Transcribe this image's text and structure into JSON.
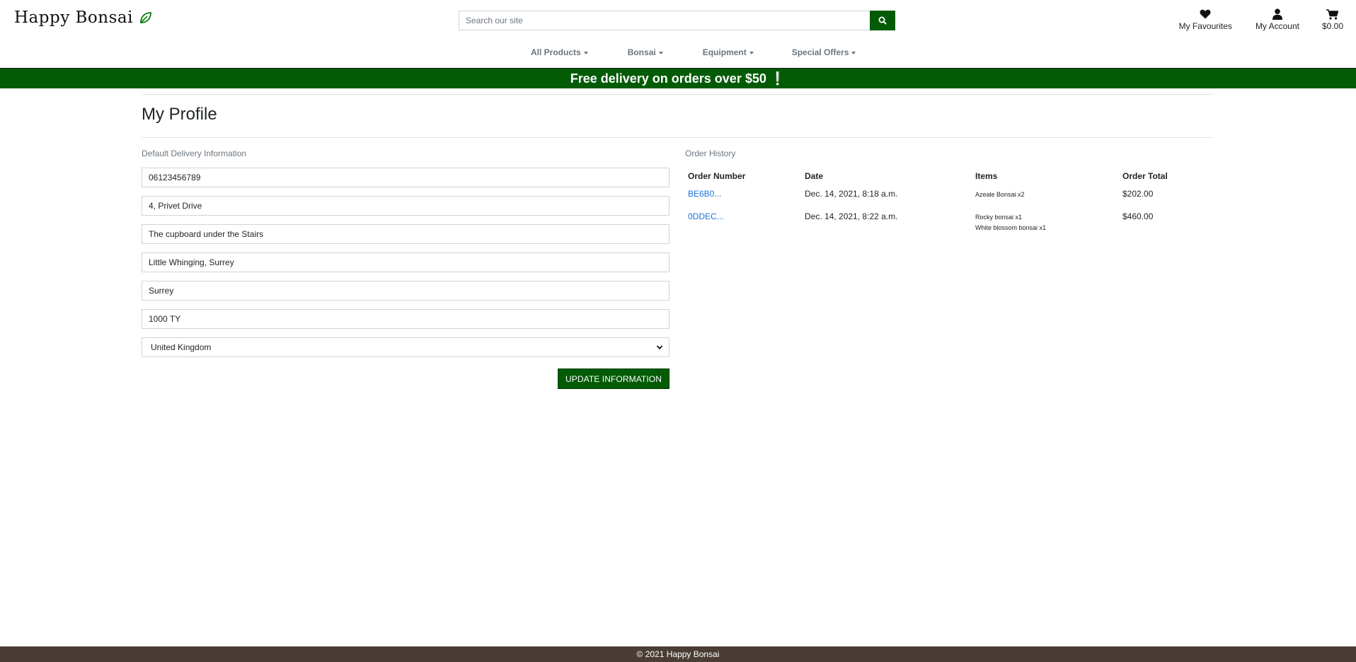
{
  "header": {
    "logo_text": "Happy Bonsai",
    "search_placeholder": "Search our site",
    "favourites_label": "My Favourites",
    "account_label": "My Account",
    "cart_total": "$0.00"
  },
  "nav": {
    "items": [
      {
        "label": "All Products"
      },
      {
        "label": "Bonsai"
      },
      {
        "label": "Equipment"
      },
      {
        "label": "Special Offers"
      }
    ]
  },
  "banner": {
    "text": "Free delivery on orders over $50",
    "mark": "❕"
  },
  "profile": {
    "title": "My Profile",
    "delivery_label": "Default Delivery Information",
    "fields": {
      "phone": "06123456789",
      "street1": "4, Privet Drive",
      "street2": "The cupboard under the Stairs",
      "town": "Little Whinging, Surrey",
      "county": "Surrey",
      "postcode": "1000 TY",
      "country": "United Kingdom"
    },
    "update_label": "Update Information"
  },
  "history": {
    "label": "Order History",
    "columns": [
      "Order Number",
      "Date",
      "Items",
      "Order Total"
    ],
    "rows": [
      {
        "number": "BE6B0...",
        "date": "Dec. 14, 2021, 8:18 a.m.",
        "items": [
          "Azeale Bonsai x2"
        ],
        "total": "$202.00"
      },
      {
        "number": "0DDEC...",
        "date": "Dec. 14, 2021, 8:22 a.m.",
        "items": [
          "Rocky bonsai x1",
          "White blossom bonsai x1"
        ],
        "total": "$460.00"
      }
    ]
  },
  "footer": {
    "text": "© 2021 Happy Bonsai"
  },
  "colors": {
    "brand_green": "#045b06",
    "footer_brown": "#4a3d36",
    "link_blue": "#1a73d9"
  },
  "icons": [
    "leaf-icon",
    "search-icon",
    "heart-icon",
    "user-icon",
    "cart-icon",
    "caret-down-icon",
    "chevron-down-icon"
  ]
}
